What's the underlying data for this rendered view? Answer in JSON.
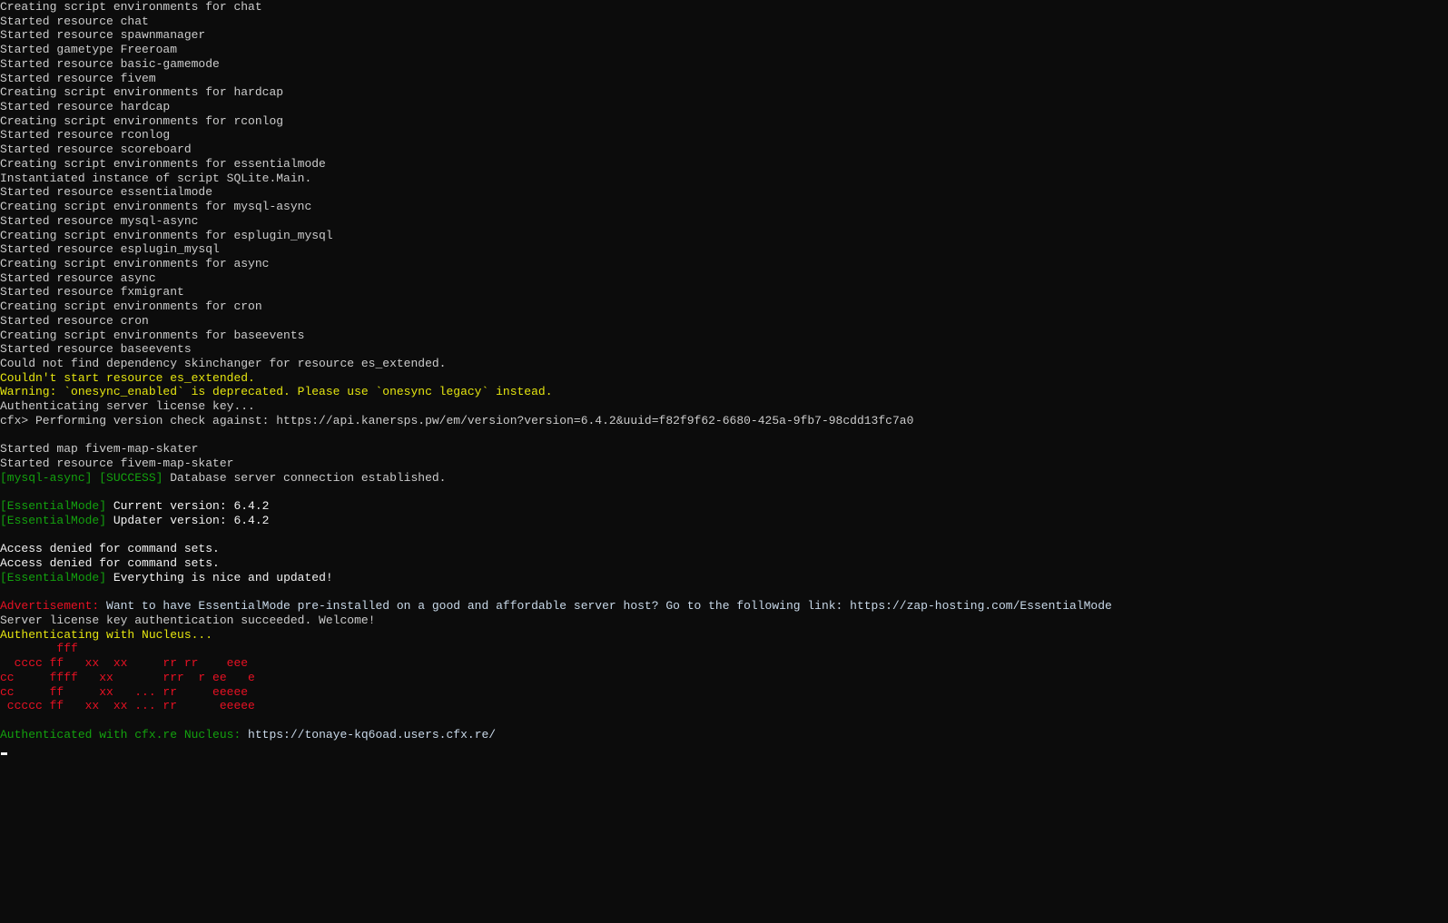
{
  "colors": {
    "gray": "#cccccc",
    "white": "#f2f2f2",
    "yellow": "#f9f1a5",
    "yellow2": "#e5e510",
    "green": "#13a10e",
    "red": "#e81123",
    "lightblue": "#c8d8e8",
    "bg": "#0c0c0c"
  },
  "lines": [
    [
      {
        "t": "Creating script environments for chat",
        "c": "gray"
      }
    ],
    [
      {
        "t": "Started resource chat",
        "c": "gray"
      }
    ],
    [
      {
        "t": "Started resource spawnmanager",
        "c": "gray"
      }
    ],
    [
      {
        "t": "Started gametype Freeroam",
        "c": "gray"
      }
    ],
    [
      {
        "t": "Started resource basic-gamemode",
        "c": "gray"
      }
    ],
    [
      {
        "t": "Started resource fivem",
        "c": "gray"
      }
    ],
    [
      {
        "t": "Creating script environments for hardcap",
        "c": "gray"
      }
    ],
    [
      {
        "t": "Started resource hardcap",
        "c": "gray"
      }
    ],
    [
      {
        "t": "Creating script environments for rconlog",
        "c": "gray"
      }
    ],
    [
      {
        "t": "Started resource rconlog",
        "c": "gray"
      }
    ],
    [
      {
        "t": "Started resource scoreboard",
        "c": "gray"
      }
    ],
    [
      {
        "t": "Creating script environments for essentialmode",
        "c": "gray"
      }
    ],
    [
      {
        "t": "Instantiated instance of script SQLite.Main.",
        "c": "gray"
      }
    ],
    [
      {
        "t": "Started resource essentialmode",
        "c": "gray"
      }
    ],
    [
      {
        "t": "Creating script environments for mysql-async",
        "c": "gray"
      }
    ],
    [
      {
        "t": "Started resource mysql-async",
        "c": "gray"
      }
    ],
    [
      {
        "t": "Creating script environments for esplugin_mysql",
        "c": "gray"
      }
    ],
    [
      {
        "t": "Started resource esplugin_mysql",
        "c": "gray"
      }
    ],
    [
      {
        "t": "Creating script environments for async",
        "c": "gray"
      }
    ],
    [
      {
        "t": "Started resource async",
        "c": "gray"
      }
    ],
    [
      {
        "t": "Started resource fxmigrant",
        "c": "gray"
      }
    ],
    [
      {
        "t": "Creating script environments for cron",
        "c": "gray"
      }
    ],
    [
      {
        "t": "Started resource cron",
        "c": "gray"
      }
    ],
    [
      {
        "t": "Creating script environments for baseevents",
        "c": "gray"
      }
    ],
    [
      {
        "t": "Started resource baseevents",
        "c": "gray"
      }
    ],
    [
      {
        "t": "Could not find dependency skinchanger for resource es_extended.",
        "c": "gray"
      }
    ],
    [
      {
        "t": "Couldn't start resource es_extended.",
        "c": "yellow2"
      }
    ],
    [
      {
        "t": "Warning: `onesync_enabled` is deprecated. Please use `onesync legacy` instead.",
        "c": "yellow2"
      }
    ],
    [
      {
        "t": "Authenticating server license key...",
        "c": "gray"
      }
    ],
    [
      {
        "t": "cfx> Performing version check against: https://api.kanersps.pw/em/version?version=6.4.2&uuid=f82f9f62-6680-425a-9fb7-98cdd13fc7a0",
        "c": "gray"
      }
    ],
    [],
    [
      {
        "t": "Started map fivem-map-skater",
        "c": "gray"
      }
    ],
    [
      {
        "t": "Started resource fivem-map-skater",
        "c": "gray"
      }
    ],
    [
      {
        "t": "[mysql-async] [SUCCESS]",
        "c": "green"
      },
      {
        "t": " Database server connection established.",
        "c": "gray"
      }
    ],
    [],
    [
      {
        "t": "[EssentialMode]",
        "c": "green"
      },
      {
        "t": " Current version: 6.4.2",
        "c": "white"
      }
    ],
    [
      {
        "t": "[EssentialMode]",
        "c": "green"
      },
      {
        "t": " Updater version: 6.4.2",
        "c": "white"
      }
    ],
    [],
    [
      {
        "t": "Access denied for command sets.",
        "c": "white"
      }
    ],
    [
      {
        "t": "Access denied for command sets.",
        "c": "white"
      }
    ],
    [
      {
        "t": "[EssentialMode]",
        "c": "green"
      },
      {
        "t": " Everything is nice and updated!",
        "c": "white"
      }
    ],
    [],
    [
      {
        "t": "Advertisement:",
        "c": "red"
      },
      {
        "t": " Want to have EssentialMode pre-installed on a good and affordable server host? Go to the following link: https://zap-hosting.com/EssentialMode",
        "c": "lightblue"
      }
    ],
    [
      {
        "t": "Server license key authentication succeeded. Welcome!",
        "c": "gray"
      }
    ],
    [
      {
        "t": "Authenticating with Nucleus...",
        "c": "yellow2"
      }
    ],
    [
      {
        "t": "        fff",
        "c": "red"
      }
    ],
    [
      {
        "t": "  cccc ff   xx  xx     rr rr    eee",
        "c": "red"
      }
    ],
    [
      {
        "t": "cc     ffff   xx       rrr  r ee   e",
        "c": "red"
      }
    ],
    [
      {
        "t": "cc     ff     xx   ... rr     eeeee",
        "c": "red"
      }
    ],
    [
      {
        "t": " ccccc ff   xx  xx ... rr      eeeee",
        "c": "red"
      }
    ],
    [],
    [
      {
        "t": "Authenticated with cfx.re Nucleus:",
        "c": "green"
      },
      {
        "t": " https://tonaye-kq6oad.users.cfx.re/",
        "c": "lightblue"
      }
    ]
  ]
}
